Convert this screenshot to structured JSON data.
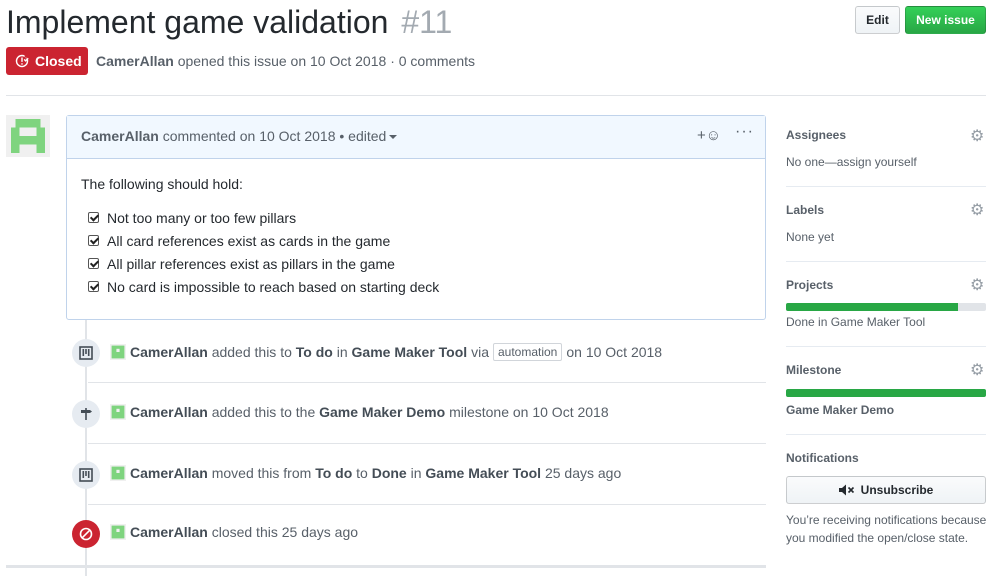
{
  "issue": {
    "title": "Implement game validation",
    "number": "#11",
    "state": "Closed",
    "author": "CamerAllan",
    "opened_text": "opened this issue on 10 Oct 2018",
    "separator": "·",
    "comments_count": "0 comments"
  },
  "header_buttons": {
    "edit": "Edit",
    "new_issue": "New issue"
  },
  "comment": {
    "author": "CamerAllan",
    "meta": "commented on 10 Oct 2018",
    "edited": "• edited",
    "reaction": "+☺",
    "more": "···",
    "intro": "The following should hold:",
    "tasks": [
      "Not too many or too few pillars",
      "All card references exist as cards in the game",
      "All pillar references exist as pillars in the game",
      "No card is impossible to reach based on starting deck"
    ]
  },
  "timeline": [
    {
      "icon": "project-icon",
      "actor": "CamerAllan",
      "t1": "added this to",
      "b1": "To do",
      "t2": "in",
      "b2": "Game Maker Tool",
      "t3": "via",
      "pill": "automation",
      "t4": "on 10 Oct 2018"
    },
    {
      "icon": "milestone-icon",
      "actor": "CamerAllan",
      "t1": "added this to the",
      "b1": "Game Maker Demo",
      "t2": "milestone on 10 Oct 2018"
    },
    {
      "icon": "project-icon",
      "actor": "CamerAllan",
      "t1": "moved this from",
      "b1": "To do",
      "t2": "to",
      "b2": "Done",
      "t3": "in",
      "b3": "Game Maker Tool",
      "t4": "25 days ago"
    },
    {
      "icon": "closed-icon",
      "actor": "CamerAllan",
      "t1": "closed this 25 days ago"
    }
  ],
  "sidebar": {
    "assignees": {
      "heading": "Assignees",
      "value": "No one—assign yourself"
    },
    "labels": {
      "heading": "Labels",
      "value": "None yet"
    },
    "projects": {
      "heading": "Projects",
      "progress": 0.86,
      "value": "Done in Game Maker Tool"
    },
    "milestone": {
      "heading": "Milestone",
      "progress": 1.0,
      "value": "Game Maker Demo"
    },
    "notifications": {
      "heading": "Notifications",
      "button": "Unsubscribe",
      "text": "You’re receiving notifications because you modified the open/close state."
    }
  },
  "colors": {
    "closed": "#cb2431",
    "green": "#28a745",
    "link": "#0366d6"
  }
}
